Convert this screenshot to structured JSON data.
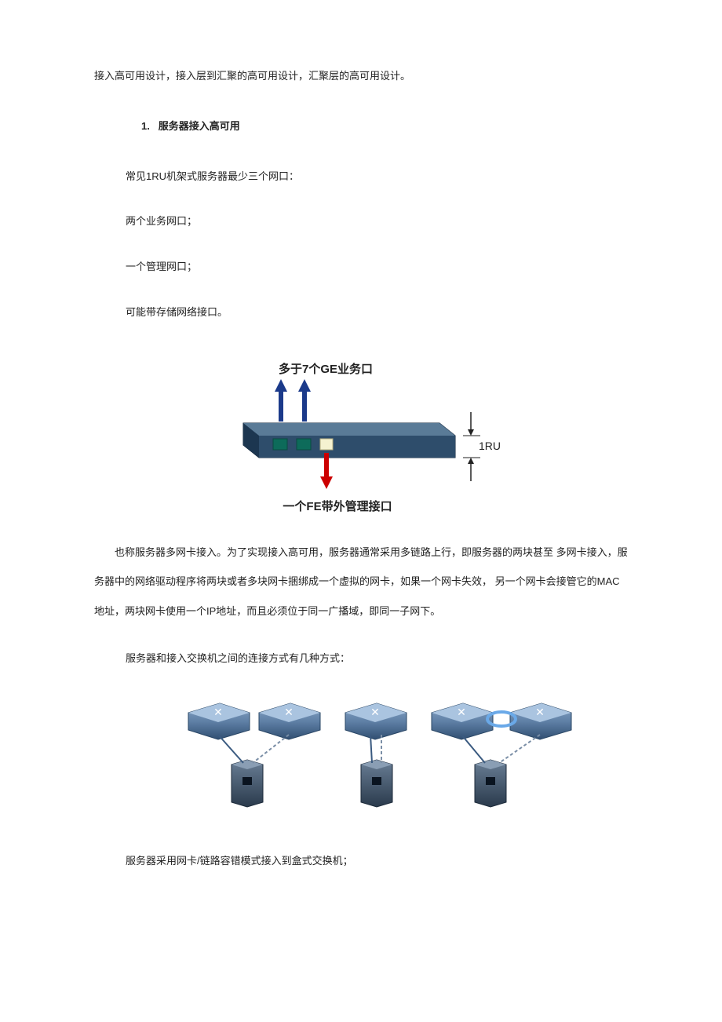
{
  "intro": "接入高可用设计，接入层到汇聚的高可用设计，汇聚层的高可用设计。",
  "section": {
    "number": "1.",
    "title": "服务器接入高可用"
  },
  "lines": {
    "l1": "常见1RU机架式服务器最少三个网口：",
    "l2": "两个业务网口；",
    "l3": "一个管理网口；",
    "l4": "可能带存储网络接口。"
  },
  "figure1": {
    "top_caption": "多于7个GE业务口",
    "bottom_caption": "一个FE带外管理接口",
    "height_label": "1RU"
  },
  "paragraph2": "也称服务器多网卡接入。为了实现接入高可用，服务器通常采用多链路上行，即服务器的两块甚至 多网卡接入，服务器中的网络驱动程序将两块或者多块网卡捆绑成一个虚拟的网卡，如果一个网卡失效，  另一个网卡会接管它的MAC地址，两块网卡使用一个IP地址，而且必须位于同一广播域，即同一子网下。",
  "figure2": {
    "caption": "服务器和接入交换机之间的连接方式有几种方式："
  },
  "paragraph3": "服务器采用网卡/链路容错模式接入到盒式交换机；"
}
